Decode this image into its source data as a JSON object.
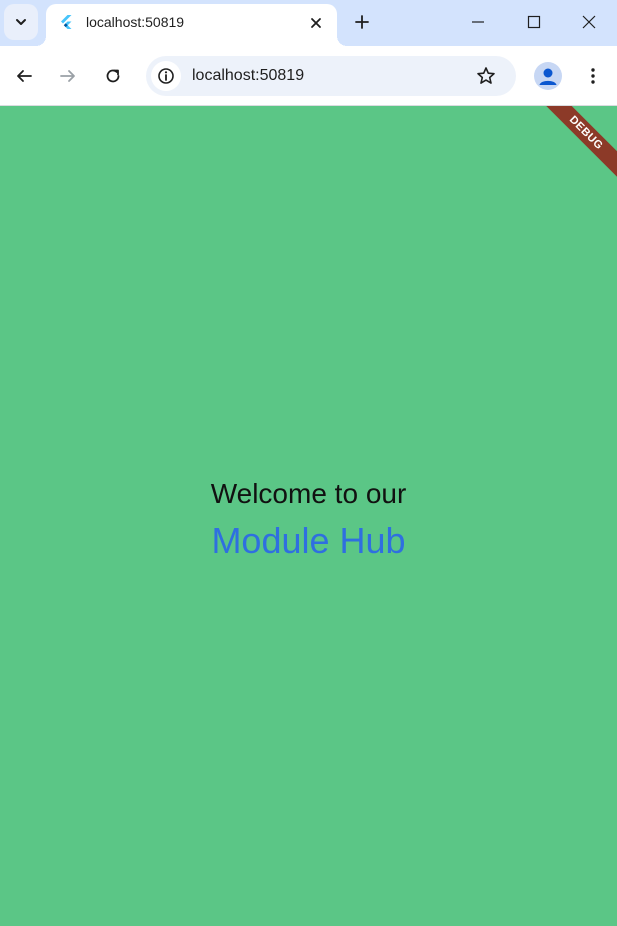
{
  "browser": {
    "tab": {
      "title": "localhost:50819"
    },
    "address_bar": {
      "url": "localhost:50819"
    }
  },
  "page": {
    "background_color": "#5bc686",
    "welcome_text": "Welcome to our",
    "hub_text": "Module Hub",
    "hub_color": "#2f6fe0",
    "debug_banner": "DEBUG"
  },
  "icons": {
    "tab_search": "chevron-down-icon",
    "favicon": "flutter-icon",
    "tab_close": "close-icon",
    "new_tab": "plus-icon",
    "minimize": "minimize-icon",
    "maximize": "maximize-icon",
    "close_window": "close-icon",
    "back": "arrow-left-icon",
    "forward": "arrow-right-icon",
    "reload": "reload-icon",
    "site_info": "info-icon",
    "bookmark": "star-icon",
    "profile": "person-icon",
    "menu": "kebab-menu-icon"
  }
}
